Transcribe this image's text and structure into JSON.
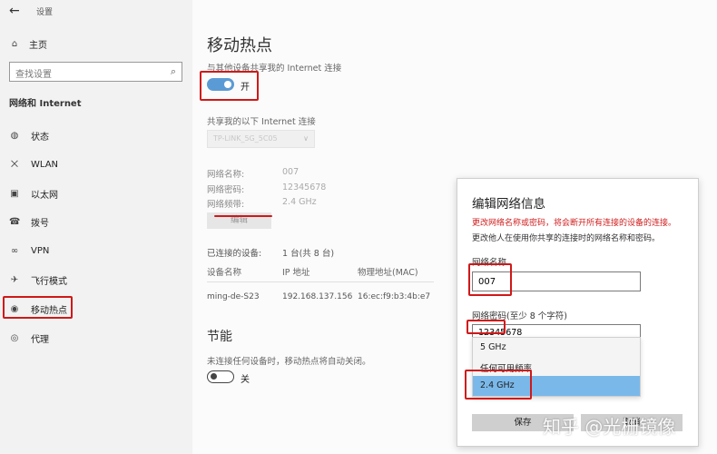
{
  "window": {
    "back_icon": "back-arrow-icon",
    "title": "设置"
  },
  "sidebar": {
    "home_label": "主页",
    "search_placeholder": "查找设置",
    "section_label": "网络和 Internet",
    "items": [
      {
        "label": "状态",
        "icon": "globe-status-icon"
      },
      {
        "label": "WLAN",
        "icon": "wifi-icon"
      },
      {
        "label": "以太网",
        "icon": "ethernet-icon"
      },
      {
        "label": "拨号",
        "icon": "dialup-icon"
      },
      {
        "label": "VPN",
        "icon": "vpn-icon"
      },
      {
        "label": "飞行模式",
        "icon": "airplane-icon"
      },
      {
        "label": "移动热点",
        "icon": "hotspot-icon"
      },
      {
        "label": "代理",
        "icon": "globe-proxy-icon"
      }
    ]
  },
  "main": {
    "title": "移动热点",
    "share_description": "与其他设备共享我的 Internet 连接",
    "hotspot_toggle": {
      "state": "on",
      "label": "开"
    },
    "share_from_label": "共享我的以下 Internet 连接",
    "share_from_value": "TP-LINK_5G_5C05",
    "info": {
      "name_label": "网络名称:",
      "name_value": "007",
      "password_label": "网络密码:",
      "password_value": "12345678",
      "band_label": "网络频带:",
      "band_value": "2.4 GHz"
    },
    "edit_button": "编辑",
    "connected_label": "已连接的设备:",
    "connected_value": "1 台(共 8 台)",
    "table": {
      "headers": [
        "设备名称",
        "IP 地址",
        "物理地址(MAC)"
      ],
      "rows": [
        [
          "ming-de-S23",
          "192.168.137.156",
          "16:ec:f9:b3:4b:e7"
        ]
      ]
    },
    "power_saving": {
      "title": "节能",
      "description": "未连接任何设备时，移动热点将自动关闭。",
      "toggle_state": "off",
      "toggle_label": "关"
    }
  },
  "dialog": {
    "title": "编辑网络信息",
    "warning": "更改网络名称或密码，将会断开所有连接的设备的连接。",
    "note": "更改他人在使用你共享的连接时的网络名称和密码。",
    "name_label": "网络名称",
    "name_value": "007",
    "password_label": "网络密码(至少 8 个字符)",
    "password_value": "12345678",
    "band_options": [
      "5 GHz",
      "任何可用频率",
      "2.4 GHz"
    ],
    "band_selected": "2.4 GHz",
    "save_button": "保存",
    "cancel_button": "取消"
  },
  "watermark": "知乎 @光栅镜像",
  "colors": {
    "accent": "#5b9bd5",
    "annotation": "#d01818",
    "selected_option": "#7ab8ea",
    "warning_text": "#d02020"
  }
}
